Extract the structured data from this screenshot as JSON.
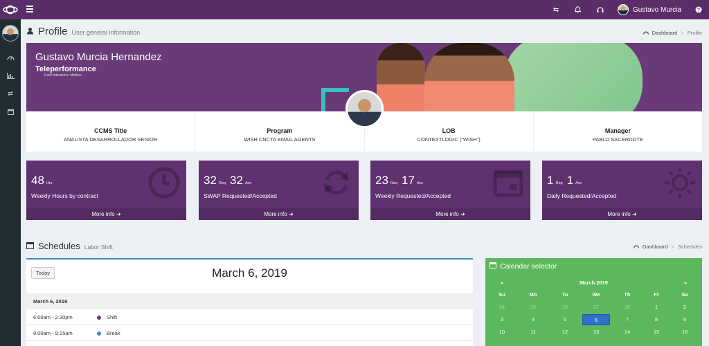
{
  "topbar": {
    "user_name": "Gustavo Murcia",
    "icons": [
      "transfer-icon",
      "bell-icon",
      "headset-icon",
      "help-icon"
    ]
  },
  "sidebar": {
    "items": [
      {
        "icon": "dashboard-icon"
      },
      {
        "icon": "chart-icon"
      },
      {
        "icon": "exchange-icon"
      },
      {
        "icon": "calendar-icon"
      }
    ]
  },
  "profile": {
    "title": "Profile",
    "subtitle": "User general information",
    "breadcrumb": [
      "Dashboard",
      "Profile"
    ],
    "banner_name": "Gustavo Murcia Hernandez",
    "brand": "Teleperformance",
    "tagline": "Each interaction Matters",
    "info": [
      {
        "label": "CCMS Title",
        "value": "ANALISTA DESARROLLADOR SENIOR"
      },
      {
        "label": "Program",
        "value": "WISH CNCTA EMAIL AGENTS"
      },
      {
        "label": "LOB",
        "value": "CONTEXTLOGIC (\"WISH\")"
      },
      {
        "label": "Manager",
        "value": "PABLO SACERDOTE"
      }
    ]
  },
  "stats": [
    {
      "v1": "48",
      "u1": "Hrs",
      "v2": "",
      "u2": "",
      "label": "Weekly Hours by contract",
      "more": "More info",
      "icon": "clock-icon"
    },
    {
      "v1": "32",
      "u1": "Req",
      "v2": "32",
      "u2": "Acc",
      "label": "SWAP Requested/Accepted",
      "more": "More info",
      "icon": "refresh-icon"
    },
    {
      "v1": "23",
      "u1": "Req",
      "v2": "17",
      "u2": "Acc",
      "label": "Weekly Requested/Accepted",
      "more": "More info",
      "icon": "calendar-icon"
    },
    {
      "v1": "1",
      "u1": "Req",
      "v2": "1",
      "u2": "Acc",
      "label": "Daily Requested/Accepted",
      "more": "More info",
      "icon": "sun-icon"
    }
  ],
  "schedules": {
    "title": "Schedules",
    "subtitle": "Labor Shift",
    "breadcrumb": [
      "Dashboard",
      "Schedules"
    ],
    "today_label": "Today",
    "current_date": "March 6, 2019",
    "list_date": "March 6, 2019",
    "events": [
      {
        "time": "6:00am - 2:30pm",
        "name": "Shift",
        "color": "#6a3a78"
      },
      {
        "time": "8:00am - 8:15am",
        "name": "Break",
        "color": "#3c8dbc"
      }
    ]
  },
  "calendar": {
    "title": "Calendar selector",
    "month": "March 2019",
    "prev": "«",
    "next": "»",
    "days": [
      "Su",
      "Mo",
      "Tu",
      "We",
      "Th",
      "Fr",
      "Sa"
    ],
    "weeks": [
      [
        "24",
        "25",
        "26",
        "27",
        "28",
        "1",
        "2"
      ],
      [
        "3",
        "4",
        "5",
        "6",
        "7",
        "8",
        "9"
      ],
      [
        "10",
        "11",
        "12",
        "13",
        "14",
        "15",
        "16"
      ]
    ],
    "prev_month_count": 5,
    "selected": "6"
  }
}
